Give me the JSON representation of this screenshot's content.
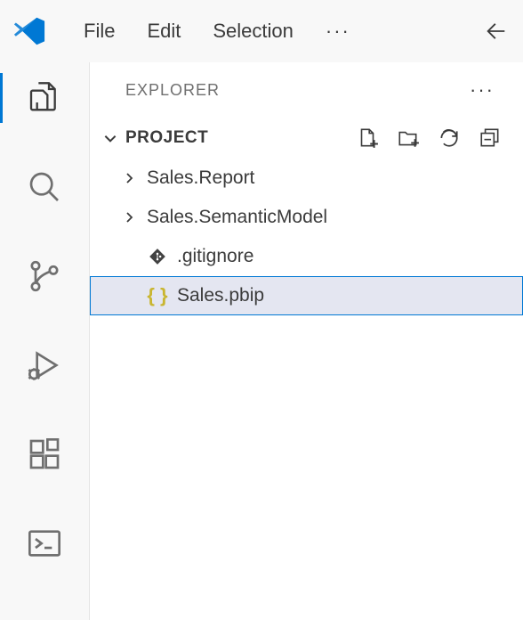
{
  "menubar": {
    "file": "File",
    "edit": "Edit",
    "selection": "Selection",
    "more": "···"
  },
  "sidebar": {
    "title": "EXPLORER",
    "more": "···",
    "section": {
      "title": "PROJECT"
    }
  },
  "tree": {
    "items": [
      {
        "label": "Sales.Report"
      },
      {
        "label": "Sales.SemanticModel"
      },
      {
        "label": ".gitignore"
      },
      {
        "label": "Sales.pbip"
      }
    ]
  }
}
